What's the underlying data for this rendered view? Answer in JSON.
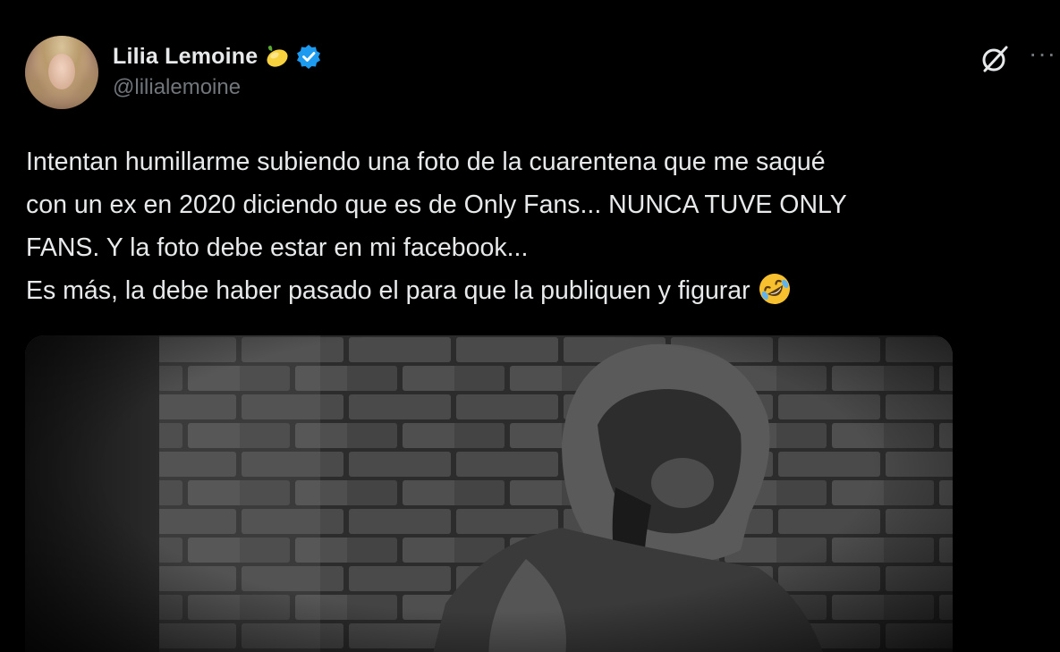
{
  "author": {
    "display_name": "Lilia Lemoine",
    "handle": "@lilialemoine",
    "avatar_icon": "profile-photo",
    "badges": [
      "lemon-icon",
      "verified-icon"
    ],
    "verified_color": "#1d9bf0"
  },
  "header_actions": {
    "grok_icon": "grok-icon",
    "more_icon": "more-icon",
    "more_label": "···"
  },
  "tweet": {
    "lines": [
      "Intentan humillarme subiendo una foto de la cuarentena que me saqué",
      "con un ex en 2020 diciendo que es de Only Fans... NUNCA TUVE ONLY",
      "FANS. Y la foto debe estar en mi facebook...",
      "Es más, la debe haber pasado el para que la publiquen y figurar"
    ],
    "trailing_emoji": "rolling-on-the-floor-laughing-emoji"
  },
  "media": {
    "type": "photo",
    "description_icon": "brick-wall-hooded-person-photo"
  },
  "colors": {
    "background": "#000000",
    "text": "#e7e9ea",
    "secondary_text": "#71767b",
    "accent": "#1d9bf0"
  }
}
